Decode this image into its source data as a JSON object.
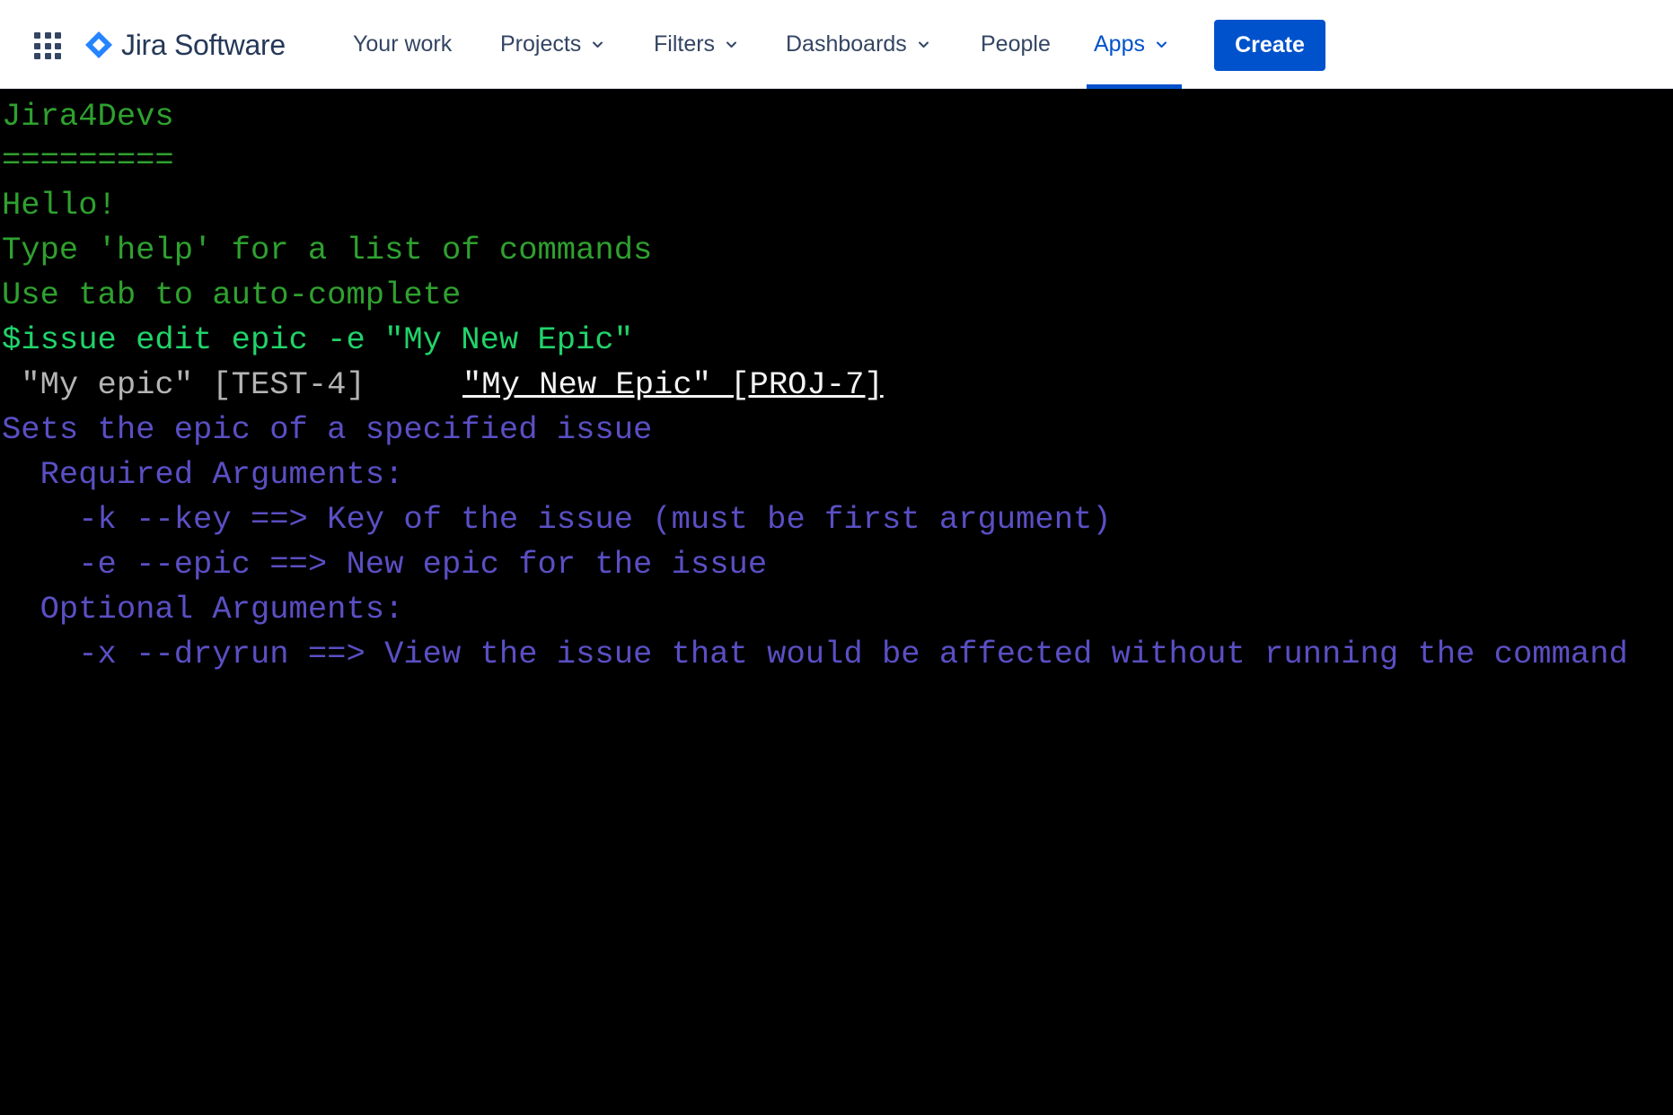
{
  "navbar": {
    "logo_text": "Jira Software",
    "items": [
      {
        "label": "Your work"
      },
      {
        "label": "Projects"
      },
      {
        "label": "Filters"
      },
      {
        "label": "Dashboards"
      },
      {
        "label": "People"
      },
      {
        "label": "Apps"
      }
    ],
    "create_label": "Create",
    "active_item": "Apps"
  },
  "terminal": {
    "title": "Jira4Devs",
    "title_underline": "=========",
    "greeting": "Hello!",
    "help_hint": "Type 'help' for a list of commands",
    "tab_hint": "Use tab to auto-complete",
    "prompt_symbol": "$",
    "command": "issue edit epic -e \"My New Epic\"",
    "suggestions": [
      {
        "text": " \"My epic\" [TEST-4]",
        "selected": false
      },
      {
        "text": "\"My New Epic\" [PROJ-7]",
        "selected": true
      }
    ],
    "help": {
      "description": "Sets the epic of a specified issue",
      "required_heading": "  Required Arguments:",
      "required_args": [
        "    -k --key ==> Key of the issue (must be first argument)",
        "    -e --epic ==> New epic for the issue"
      ],
      "optional_heading": "  Optional Arguments:",
      "optional_args": [
        "    -x --dryrun ==> View the issue that would be affected without running the command"
      ]
    }
  },
  "colors": {
    "brand_blue": "#0052cc",
    "terminal_green": "#2fa12f",
    "prompt_green": "#21d36a",
    "help_purple": "#5a4fc4",
    "suggestion_gray": "#b4b4b4"
  }
}
